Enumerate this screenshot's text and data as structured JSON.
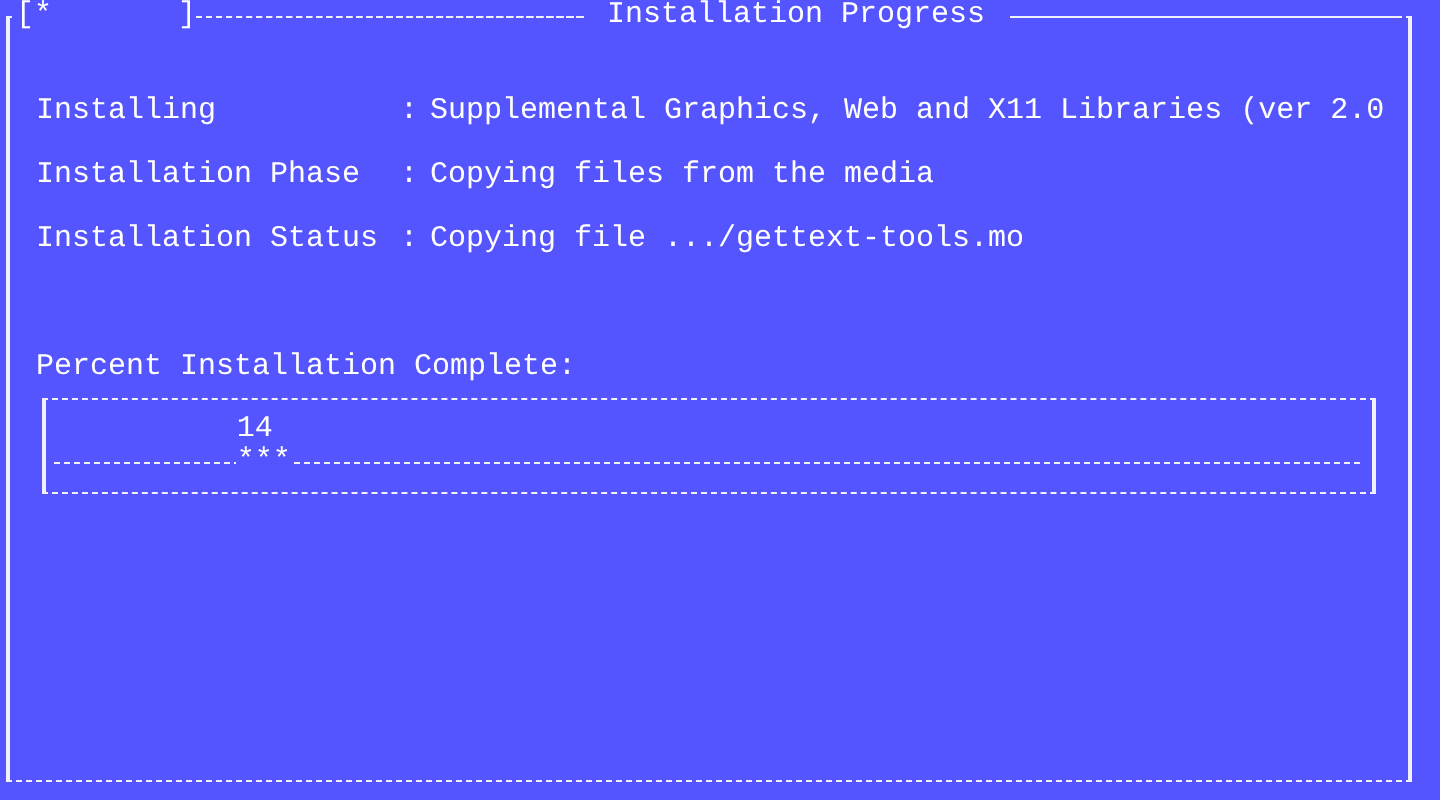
{
  "window": {
    "spinner": "[*       ]",
    "title": "Installation Progress"
  },
  "fields": [
    {
      "label": "Installing",
      "separator": ":",
      "value": "Supplemental Graphics, Web and X11 Libraries (ver 2.0"
    },
    {
      "label": "Installation Phase",
      "separator": ":",
      "value": "Copying files from the media"
    },
    {
      "label": "Installation Status",
      "separator": ":",
      "value": "Copying file .../gettext-tools.mo"
    }
  ],
  "progress": {
    "label": "Percent Installation Complete:",
    "percent": "14",
    "marker": "***",
    "level": 0.14
  }
}
